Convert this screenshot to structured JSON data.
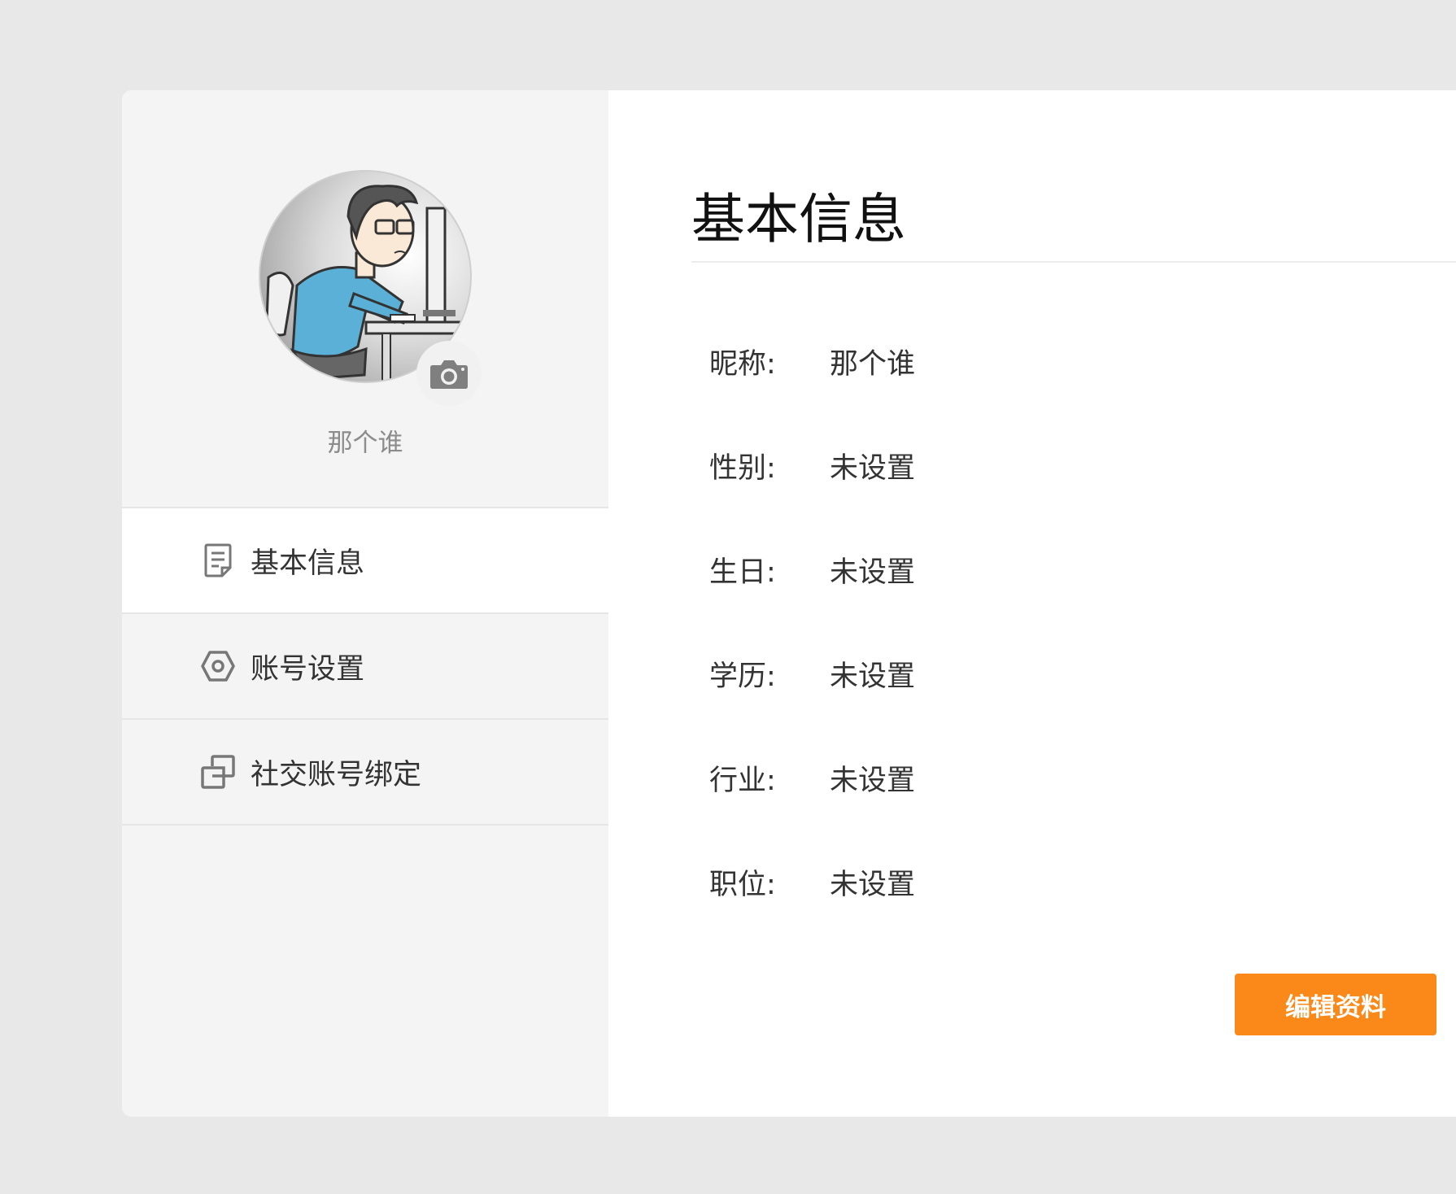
{
  "profile": {
    "nickname": "那个谁"
  },
  "sidebar": {
    "items": [
      {
        "label": "基本信息",
        "icon": "document-icon",
        "active": true
      },
      {
        "label": "账号设置",
        "icon": "settings-hexagon-icon",
        "active": false
      },
      {
        "label": "社交账号绑定",
        "icon": "link-squares-icon",
        "active": false
      }
    ]
  },
  "main": {
    "title": "基本信息",
    "fields": [
      {
        "label": "昵称:",
        "value": "那个谁"
      },
      {
        "label": "性别:",
        "value": "未设置"
      },
      {
        "label": "生日:",
        "value": "未设置"
      },
      {
        "label": "学历:",
        "value": "未设置"
      },
      {
        "label": "行业:",
        "value": "未设置"
      },
      {
        "label": "职位:",
        "value": "未设置"
      }
    ],
    "edit_label": "编辑资料"
  },
  "colors": {
    "accent": "#fa8919",
    "sidebar_bg": "#f4f4f4",
    "page_bg": "#e8e8e8"
  }
}
